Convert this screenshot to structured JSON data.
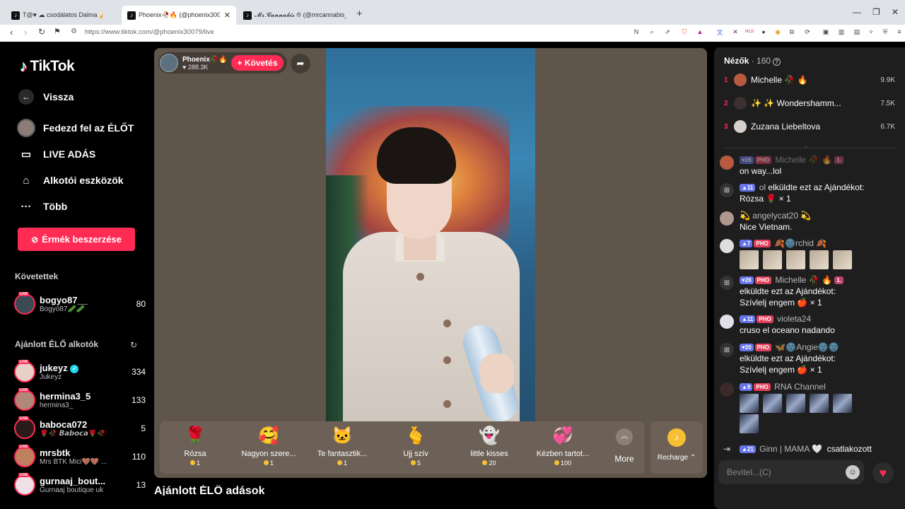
{
  "browser": {
    "tabs": [
      {
        "title": "T@♥ ☁ csodálatos Dalma🍦"
      },
      {
        "title": "Phoenix🥀🔥 (@phoenix3007"
      },
      {
        "title": "𝓜𝓻.𝓒𝓪𝓷𝓷𝓪𝓫𝓲𝓼 ® (@mrcannabis_"
      }
    ],
    "url": "https://www.tiktok.com/@phoenix30079/live"
  },
  "sidebar": {
    "logo": "TikTok",
    "back": "Vissza",
    "nav": [
      {
        "label": "Fedezd fel az ÉLŐT"
      },
      {
        "label": "LIVE ADÁS"
      },
      {
        "label": "Alkotói eszközök"
      },
      {
        "label": "Több"
      }
    ],
    "coins_button": "Érmék beszerzése",
    "following_header": "Követettek",
    "following": [
      {
        "username": "bogyo87__",
        "nickname": "Bogyó87🥒🥒",
        "count": "80"
      }
    ],
    "recommended_header": "Ajánlott ÉLŐ alkotók",
    "recommended": [
      {
        "username": "jukeyz",
        "nickname": "Jukeyz",
        "count": "334"
      },
      {
        "username": "hermina3_5",
        "nickname": "hermina3_",
        "count": "133"
      },
      {
        "username": "baboca072",
        "nickname": "🌹🥀 𝘽𝙖𝙗𝙤𝙘𝙖🌹🥀",
        "count": "5"
      },
      {
        "username": "mrsbtk",
        "nickname": "Mrs BTK Mici🤎🤎 ...",
        "count": "110"
      },
      {
        "username": "gurnaaj_bout...",
        "nickname": "Gurnaaj boutique uk",
        "count": "13"
      }
    ],
    "live_tag": "LIVE"
  },
  "stream": {
    "host_name": "Phoenix🥀🔥",
    "host_likes": "♥ 288.3K",
    "follow_label": "+ Követés",
    "gifts": [
      {
        "name": "Rózsa",
        "price": "1",
        "icon": "rose-icon",
        "glyph": "🌹"
      },
      {
        "name": "Nagyon szere...",
        "price": "1",
        "icon": "heart-face-icon",
        "glyph": "🥰"
      },
      {
        "name": "Te fantasztik...",
        "price": "1",
        "icon": "cat-icon",
        "glyph": "🐱"
      },
      {
        "name": "Ujj szív",
        "price": "5",
        "icon": "finger-heart-icon",
        "glyph": "🫰"
      },
      {
        "name": "little kisses",
        "price": "20",
        "icon": "ghost-icon",
        "glyph": "👻"
      },
      {
        "name": "Kézben tartot...",
        "price": "100",
        "icon": "hearts-icon",
        "glyph": "💞"
      }
    ],
    "more_label": "More",
    "recharge_label": "Recharge ⌃"
  },
  "below_title": "Ajánlott ÉLŐ adások",
  "panel": {
    "viewers_label": "Nézők",
    "viewers_count": "· 160",
    "top_viewers": [
      {
        "rank": "1",
        "name": "Michelle 🥀 🔥",
        "score": "9.9K"
      },
      {
        "rank": "2",
        "name": "✨ ✨ Wondershamm...",
        "score": "7.5K"
      },
      {
        "rank": "3",
        "name": "Zuzana Liebeltova",
        "score": "6.7K"
      }
    ],
    "chat": [
      {
        "level": "26",
        "badge": "PHO",
        "user": "Michelle 🥀 🔥",
        "fan": "1.",
        "text": "on way...lol"
      },
      {
        "level": "11",
        "user": "ol",
        "text1": "elküldte ezt az Ajándékot:",
        "text2": "Rózsa 🌹 × 1"
      },
      {
        "user": "💫 angelycat20 💫",
        "text": "Nice Vietnam."
      },
      {
        "level": "7",
        "badge": "PHO",
        "user": "🍂🌚rchid 🍂"
      },
      {
        "level": "26",
        "badge": "PHO",
        "user": "Michelle 🥀 🔥",
        "fan": "1.",
        "text1": "elküldte ezt az Ajándékot:",
        "text2": "Szívlelj engem 🍎 × 1"
      },
      {
        "level": "11",
        "badge": "PHO",
        "user": "violeta24",
        "text": "cruso el oceano nadando"
      },
      {
        "level": "20",
        "badge": "PHO",
        "user": "🦋🌚Angie🌚🌚",
        "text1": "elküldte ezt az Ajándékot:",
        "text2": "Szívlelj engem 🍎 × 1"
      },
      {
        "level": "9",
        "badge": "PHO",
        "user": "RNA Channel"
      }
    ],
    "joined": {
      "level": "21",
      "user": "Ginn | MAMA 🤍",
      "text": "csatlakozott"
    },
    "input_placeholder": "Bevitel...(C)"
  },
  "colors": {
    "accent": "#fe2c55",
    "level_badge": "#6574e8",
    "stage_bg": "#5f554b"
  }
}
